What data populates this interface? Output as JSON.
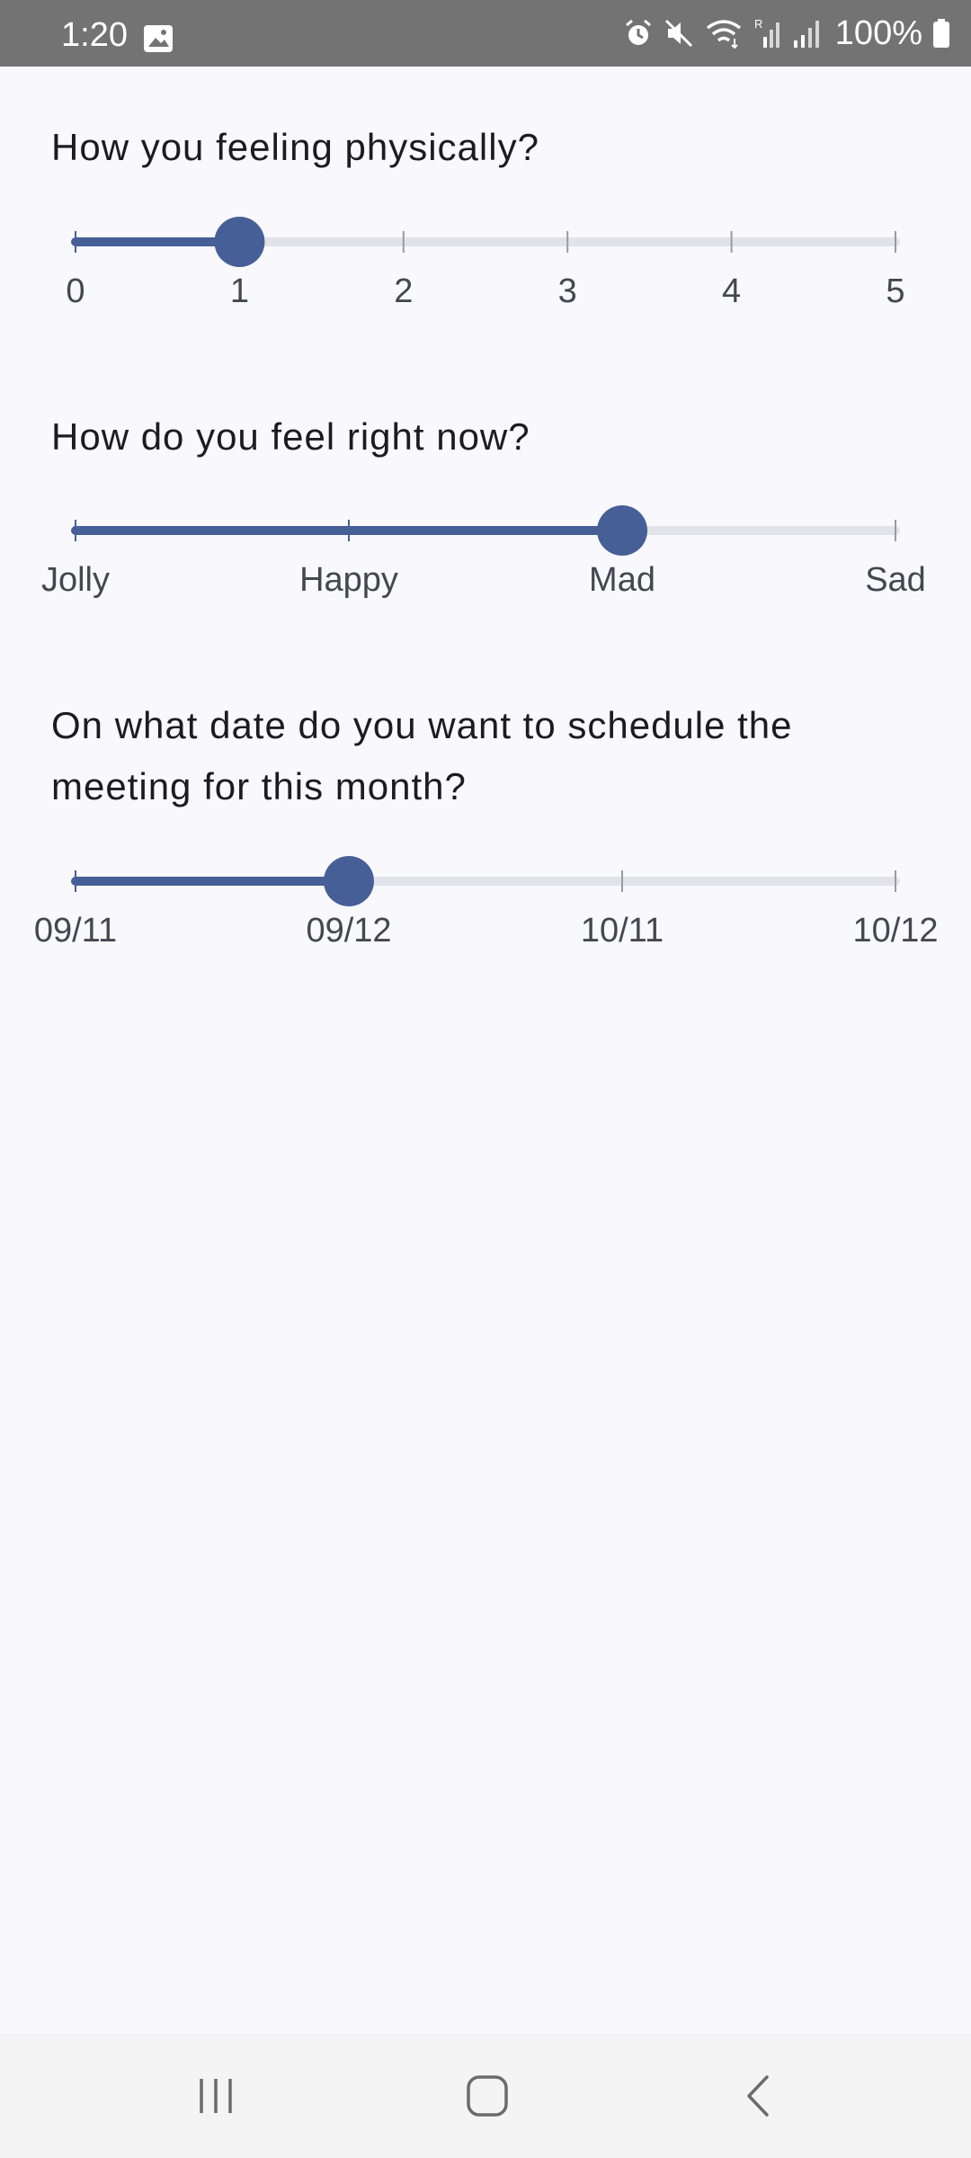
{
  "status_bar": {
    "time": "1:20",
    "battery": "100%",
    "icons": [
      "gallery-icon",
      "alarm-icon",
      "mute-icon",
      "wifi-icon",
      "roaming-signal-icon",
      "signal-icon",
      "battery-icon"
    ]
  },
  "colors": {
    "accent": "#465f96",
    "track_inactive": "#e2e2e9",
    "background": "#f9f8fd",
    "label": "#44474e",
    "text": "#1c1b1f"
  },
  "questions": [
    {
      "text": "How you feeling physically?",
      "ticks": [
        "0",
        "1",
        "2",
        "3",
        "4",
        "5"
      ],
      "selected_index": 1,
      "value_fraction": 0.2
    },
    {
      "text": "How do you feel right now?",
      "ticks": [
        "Jolly",
        "Happy",
        "Mad",
        "Sad"
      ],
      "selected_index": 2,
      "value_fraction": 0.6667
    },
    {
      "text": "On what date do you want to schedule the meeting for this month?",
      "ticks": [
        "09/11",
        "09/12",
        "10/11",
        "10/12"
      ],
      "selected_index": 1,
      "value_fraction": 0.3333
    }
  ],
  "nav_bar": {
    "buttons": [
      "recent-apps-icon",
      "home-icon",
      "back-icon"
    ]
  }
}
